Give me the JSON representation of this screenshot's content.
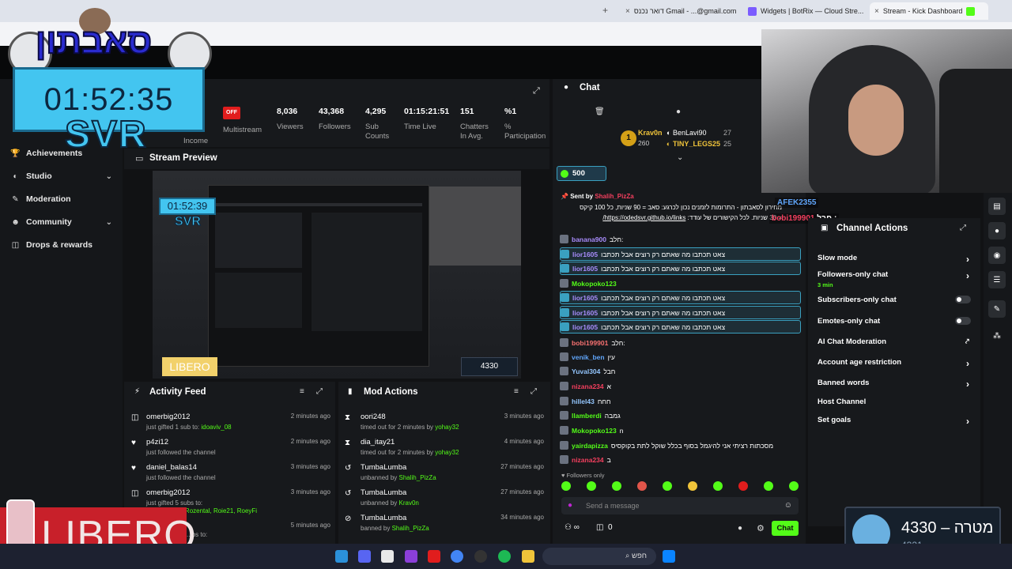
{
  "browser": {
    "tabs": [
      {
        "label": "דואר נכנס Gmail - ...@gmail.com"
      },
      {
        "label": "Widgets | BotRix — Cloud Stre..."
      },
      {
        "label": "Stream - Kick Dashboard"
      }
    ]
  },
  "overlay": {
    "timer": "01:52:35",
    "brand_top": "סאבתון",
    "brand_mid": "SVR",
    "sponsor": "LIBERO"
  },
  "stats": {
    "income_label": "Income",
    "status_badge": "OFF",
    "multistream_label": "Multistream",
    "viewers_value": "8,036",
    "viewers_label": "Viewers",
    "followers_value": "43,368",
    "followers_label": "Followers",
    "subs_value": "4,295",
    "subs_label_1": "Sub",
    "subs_label_2": "Counts",
    "timelive_value": "01:15:21:51",
    "timelive_label": "Time Live",
    "chatters_value": "151",
    "chatters_label_1": "Chatters",
    "chatters_label_2": "In Avg.",
    "participation_value": "%1",
    "participation_label_1": "%",
    "participation_label_2": "Participation"
  },
  "sidebar": {
    "items": [
      {
        "label": "Achievements",
        "icon": "trophy-icon"
      },
      {
        "label": "Studio",
        "icon": "palette-icon"
      },
      {
        "label": "Moderation",
        "icon": "wrench-icon"
      },
      {
        "label": "Community",
        "icon": "people-icon"
      },
      {
        "label": "Drops & rewards",
        "icon": "gift-icon"
      }
    ]
  },
  "preview": {
    "title": "Stream Preview",
    "inner_timer": "01:52:39",
    "inner_brand": "SVR",
    "inner_sponsor": "LIBERO",
    "inner_count": "4330"
  },
  "activity_feed": {
    "title": "Activity Feed",
    "rows": [
      {
        "name": "omerbig2012",
        "pre": "just gifted 1 sub to: ",
        "hl": "idoaviv_08",
        "time": "2 minutes ago"
      },
      {
        "name": "p4zi12",
        "pre": "just followed the channel",
        "hl": "",
        "time": "2 minutes ago"
      },
      {
        "name": "daniel_balas14",
        "pre": "just followed the channel",
        "hl": "",
        "time": "3 minutes ago"
      },
      {
        "name": "omerbig2012",
        "pre": "just gifted 5 subs to:",
        "hl": "",
        "time": "3 minutes ago"
      },
      {
        "name": "",
        "pre": "",
        "hl": "",
        "time": "5 minutes ago"
      }
    ],
    "gift_names_line": "a_itay21, RoyRozental, Roie21, RoeyFi",
    "partial_line": "...bs to:"
  },
  "mod_actions": {
    "title": "Mod Actions",
    "rows": [
      {
        "name": "oori248",
        "pre": "timed out for 2 minutes by ",
        "hl": "yohay32",
        "time": "3 minutes ago"
      },
      {
        "name": "dia_itay21",
        "pre": "timed out for 2 minutes by ",
        "hl": "yohay32",
        "time": "4 minutes ago"
      },
      {
        "name": "TumbaLumba",
        "pre": "unbanned by ",
        "hl": "Shalih_PizZa",
        "time": "27 minutes ago"
      },
      {
        "name": "TumbaLumba",
        "pre": "unbanned by ",
        "hl": "Krav0n",
        "time": "27 minutes ago"
      },
      {
        "name": "TumbaLumba",
        "pre": "banned by ",
        "hl": "Shalih_PizZa",
        "time": "34 minutes ago"
      }
    ]
  },
  "chat": {
    "title": "Chat",
    "top_gifters": [
      {
        "rank": "1",
        "name": "Krav0n",
        "value": "260"
      },
      {
        "name": "BenLavi90",
        "value": "27"
      },
      {
        "name": "TINY_LEGS25",
        "value": "25"
      }
    ],
    "pinned_amount": "500",
    "pinned_sent_by": "Sent by",
    "pinned_user": "Shalih_PizZa",
    "pinned_line1": "מחירון לסאבתון - התרומות לזמנים נכון לכרגע: סאב = 90 שניות, כל 100 קיקס",
    "pinned_line2": "= 30 שניות. לכל הקישורים של עודד: ",
    "pinned_link": "https://odedsvr.github.io/links/",
    "messages": [
      {
        "user": "banana900",
        "color": "#a78bfa",
        "text": "חלב:",
        "hl": false
      },
      {
        "user": "lior1605",
        "color": "#a78bfa",
        "text": "צאט תכתבו מה שאתם רק רוצים אבל תכתבו",
        "hl": true
      },
      {
        "user": "lior1605",
        "color": "#a78bfa",
        "text": "צאט תכתבו מה שאתם רק רוצים אבל תכתבו",
        "hl": true
      },
      {
        "user": "Mokopoko123",
        "color": "#53fc18",
        "text": "",
        "hl": false
      },
      {
        "user": "lior1605",
        "color": "#a78bfa",
        "text": "צאט תכתבו מה שאתם רק רוצים אבל תכתבו",
        "hl": true
      },
      {
        "user": "lior1605",
        "color": "#a78bfa",
        "text": "צאט תכתבו מה שאתם רק רוצים אבל תכתבו",
        "hl": true
      },
      {
        "user": "lior1605",
        "color": "#a78bfa",
        "text": "צאט תכתבו מה שאתם רק רוצים אבל תכתבו",
        "hl": true
      },
      {
        "user": "bobi199901",
        "color": "#f87171",
        "text": "חלב:",
        "hl": false
      },
      {
        "user": "venik_ben",
        "color": "#60a5fa",
        "text": "עין",
        "hl": false
      },
      {
        "user": "Yuval304",
        "color": "#93c5fd",
        "text": "חבל",
        "hl": false
      },
      {
        "user": "nizana234",
        "color": "#f43f5e",
        "text": "א",
        "hl": false
      },
      {
        "user": "hillel43",
        "color": "#93c5fd",
        "text": "חחח",
        "hl": false
      },
      {
        "user": "llamberdi",
        "color": "#53fc18",
        "text": "גמבה",
        "hl": false
      },
      {
        "user": "Mokopoko123",
        "color": "#53fc18",
        "text": "n",
        "hl": false
      },
      {
        "user": "yairdapizza",
        "color": "#53fc18",
        "text": "מסכתות רציתי אני להיגמל בסוף בכלל שוקל לתת בקוקסיס",
        "hl": false
      },
      {
        "user": "nizana234",
        "color": "#f43f5e",
        "text": "ב",
        "hl": false
      }
    ],
    "floating_1_user": "AFEK2355",
    "floating_2_user": "bobi199901",
    "floating_2_text": "חבל :",
    "followers_only": "Followers only",
    "input_placeholder": "Send a message",
    "chat_button": "Chat",
    "bottom_infinite": "∞",
    "bottom_count": "0"
  },
  "channel_actions": {
    "title": "Channel Actions",
    "rows": [
      {
        "label": "Slow mode",
        "sub": "",
        "control": "arrow"
      },
      {
        "label": "Followers-only chat",
        "sub": "3 min",
        "control": "arrow"
      },
      {
        "label": "Subscribers-only chat",
        "sub": "",
        "control": "toggle"
      },
      {
        "label": "Emotes-only chat",
        "sub": "",
        "control": "toggle"
      },
      {
        "label": "AI Chat Moderation",
        "sub": "",
        "control": "external"
      },
      {
        "label": "Account age restriction",
        "sub": "",
        "control": "arrow"
      },
      {
        "label": "Banned words",
        "sub": "",
        "control": "arrow"
      },
      {
        "label": "Host Channel",
        "sub": "",
        "control": "none"
      },
      {
        "label": "Set goals",
        "sub": "",
        "control": "arrow"
      }
    ]
  },
  "follower_widget": {
    "count": "4330",
    "dash": "–",
    "label": "מטרה",
    "sub": "4321"
  },
  "taskbar": {
    "search": "חפש"
  },
  "colors": {
    "accent": "#53fc18",
    "bg": "#111214",
    "panel": "#17191c",
    "offline": "#e11d1d"
  }
}
